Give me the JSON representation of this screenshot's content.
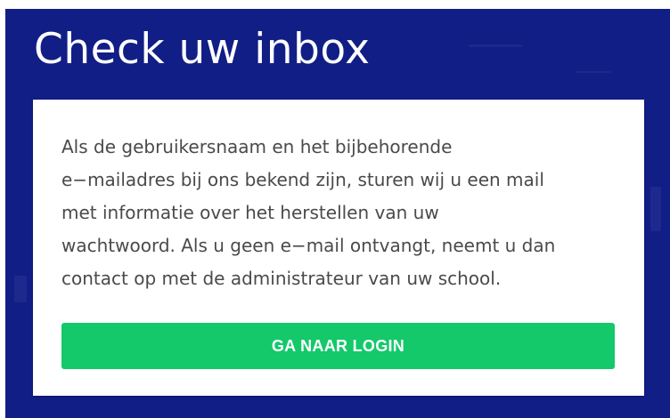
{
  "page": {
    "title": "Check uw inbox"
  },
  "card": {
    "message_lines": [
      "Als de gebruikersnaam en het bijbehorende",
      "e−mailadres bij ons bekend zijn, sturen wij u een mail",
      "met informatie over het herstellen van uw",
      "wachtwoord. Als u geen e−mail ontvangt, neemt u dan",
      "contact op met de administrateur van uw school."
    ],
    "button_label": "GA NAAR LOGIN"
  },
  "colors": {
    "background": "#111e86",
    "card": "#ffffff",
    "button": "#13c96a",
    "text": "#4a4a4a"
  }
}
